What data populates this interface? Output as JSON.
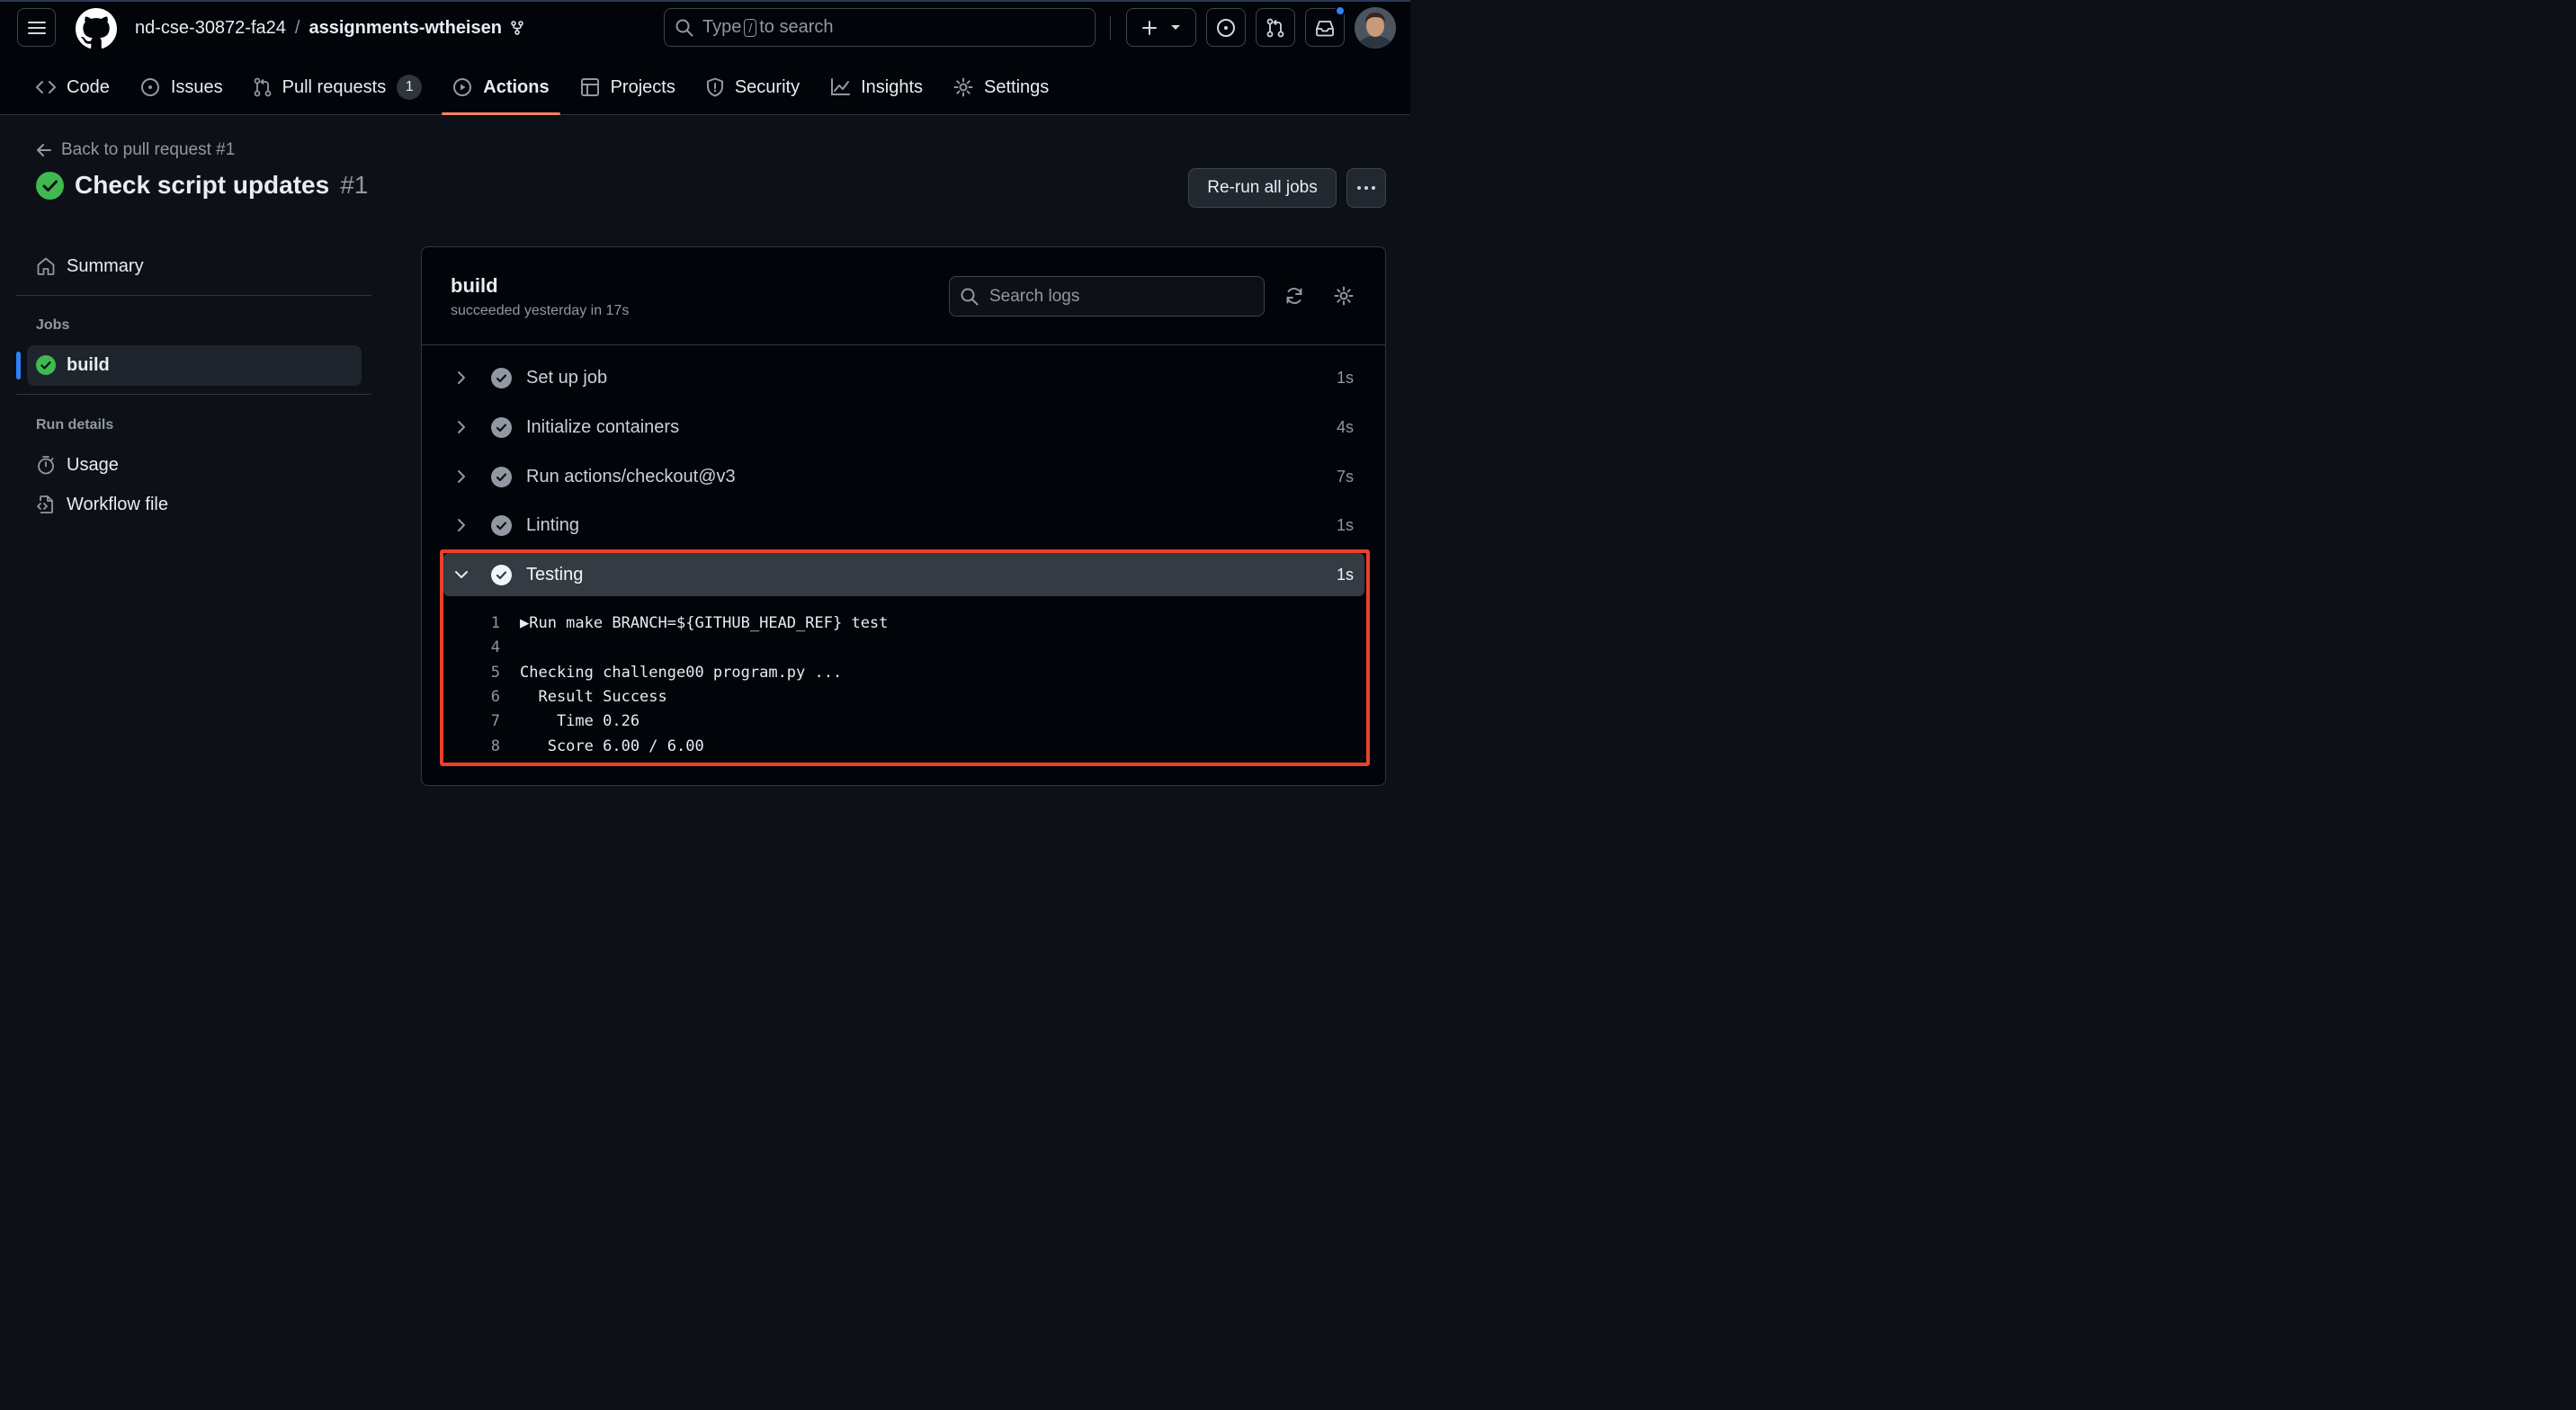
{
  "header": {
    "org": "nd-cse-30872-fa24",
    "separator": "/",
    "repo": "assignments-wtheisen",
    "search": {
      "prefix": "Type",
      "key": "/",
      "suffix": "to search"
    }
  },
  "tabs": [
    {
      "label": "Code"
    },
    {
      "label": "Issues"
    },
    {
      "label": "Pull requests",
      "count": "1"
    },
    {
      "label": "Actions",
      "selected": true
    },
    {
      "label": "Projects"
    },
    {
      "label": "Security"
    },
    {
      "label": "Insights"
    },
    {
      "label": "Settings"
    }
  ],
  "run": {
    "back_label": "Back to pull request #1",
    "title": "Check script updates",
    "number": "#1",
    "rerun_label": "Re-run all jobs"
  },
  "sidebar": {
    "summary": "Summary",
    "jobs_heading": "Jobs",
    "job": "build",
    "run_details_heading": "Run details",
    "usage": "Usage",
    "workflow_file": "Workflow file"
  },
  "job": {
    "name": "build",
    "status": "succeeded yesterday in 17s",
    "search_placeholder": "Search logs",
    "steps": [
      {
        "name": "Set up job",
        "duration": "1s"
      },
      {
        "name": "Initialize containers",
        "duration": "4s"
      },
      {
        "name": "Run actions/checkout@v3",
        "duration": "7s"
      },
      {
        "name": "Linting",
        "duration": "1s"
      },
      {
        "name": "Testing",
        "duration": "1s",
        "expanded": true
      }
    ],
    "log": [
      {
        "n": "1",
        "text": "▶Run make BRANCH=${GITHUB_HEAD_REF} test"
      },
      {
        "n": "4",
        "text": ""
      },
      {
        "n": "5",
        "text": "Checking challenge00 program.py ..."
      },
      {
        "n": "6",
        "text": "  Result Success"
      },
      {
        "n": "7",
        "text": "    Time 0.26"
      },
      {
        "n": "8",
        "text": "   Score 6.00 / 6.00"
      }
    ]
  },
  "colors": {
    "success": "#3fb950",
    "accent": "#f78166",
    "highlight": "#e8412b",
    "link": "#2f81f7"
  }
}
